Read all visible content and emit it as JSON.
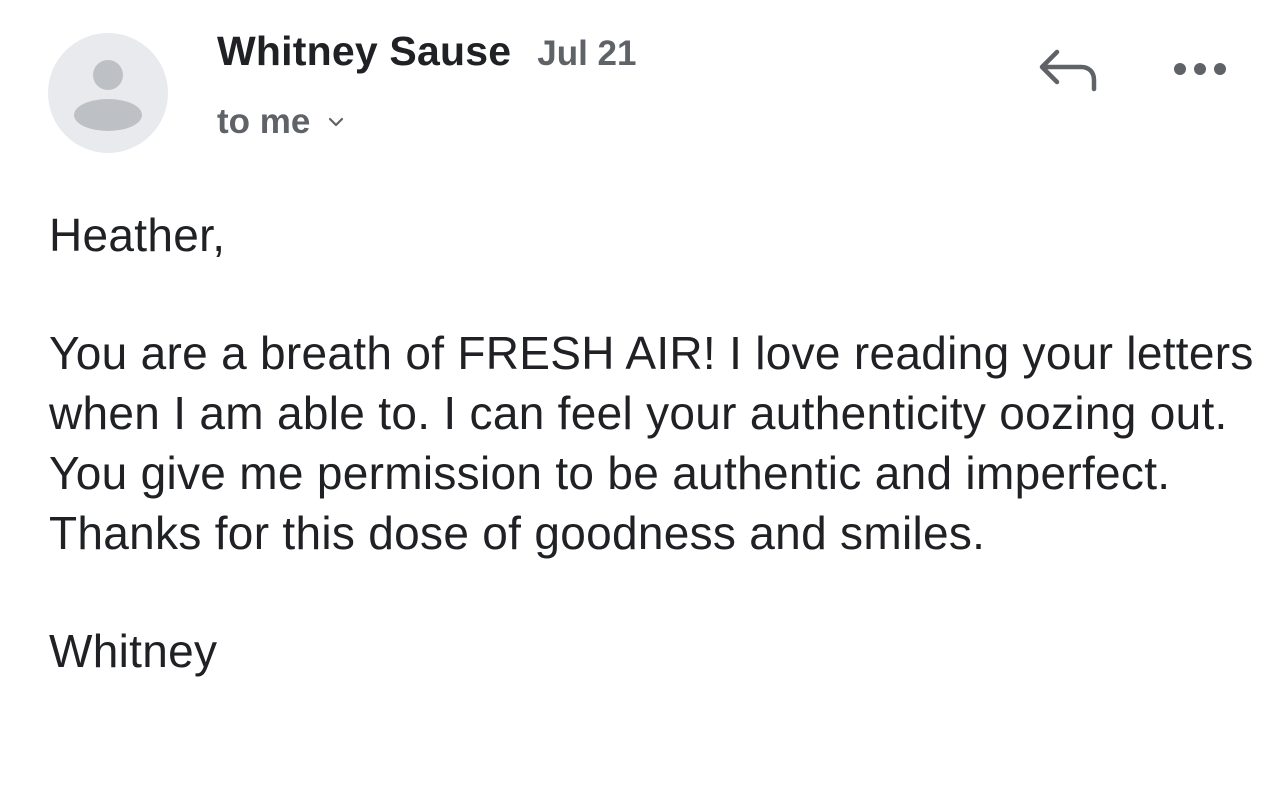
{
  "email": {
    "sender_name": "Whitney Sause",
    "date": "Jul 21",
    "recipient": "to me",
    "greeting": "Heather,",
    "body_paragraph": "You are a breath of FRESH AIR! I love reading your letters when I am able to. I can feel your authenticity oozing out. You give me permission to be authentic and imperfect. Thanks for this dose of goodness and smiles.",
    "signature": "Whitney"
  },
  "icons": {
    "avatar": "person-placeholder-icon",
    "recipient_toggle": "chevron-down-icon",
    "reply": "reply-arrow-icon",
    "more": "more-horizontal-icon"
  },
  "colors": {
    "text_primary": "#202124",
    "text_secondary": "#5f6368",
    "avatar_bg": "#e8eaed",
    "avatar_figure": "#bdc1c6"
  }
}
